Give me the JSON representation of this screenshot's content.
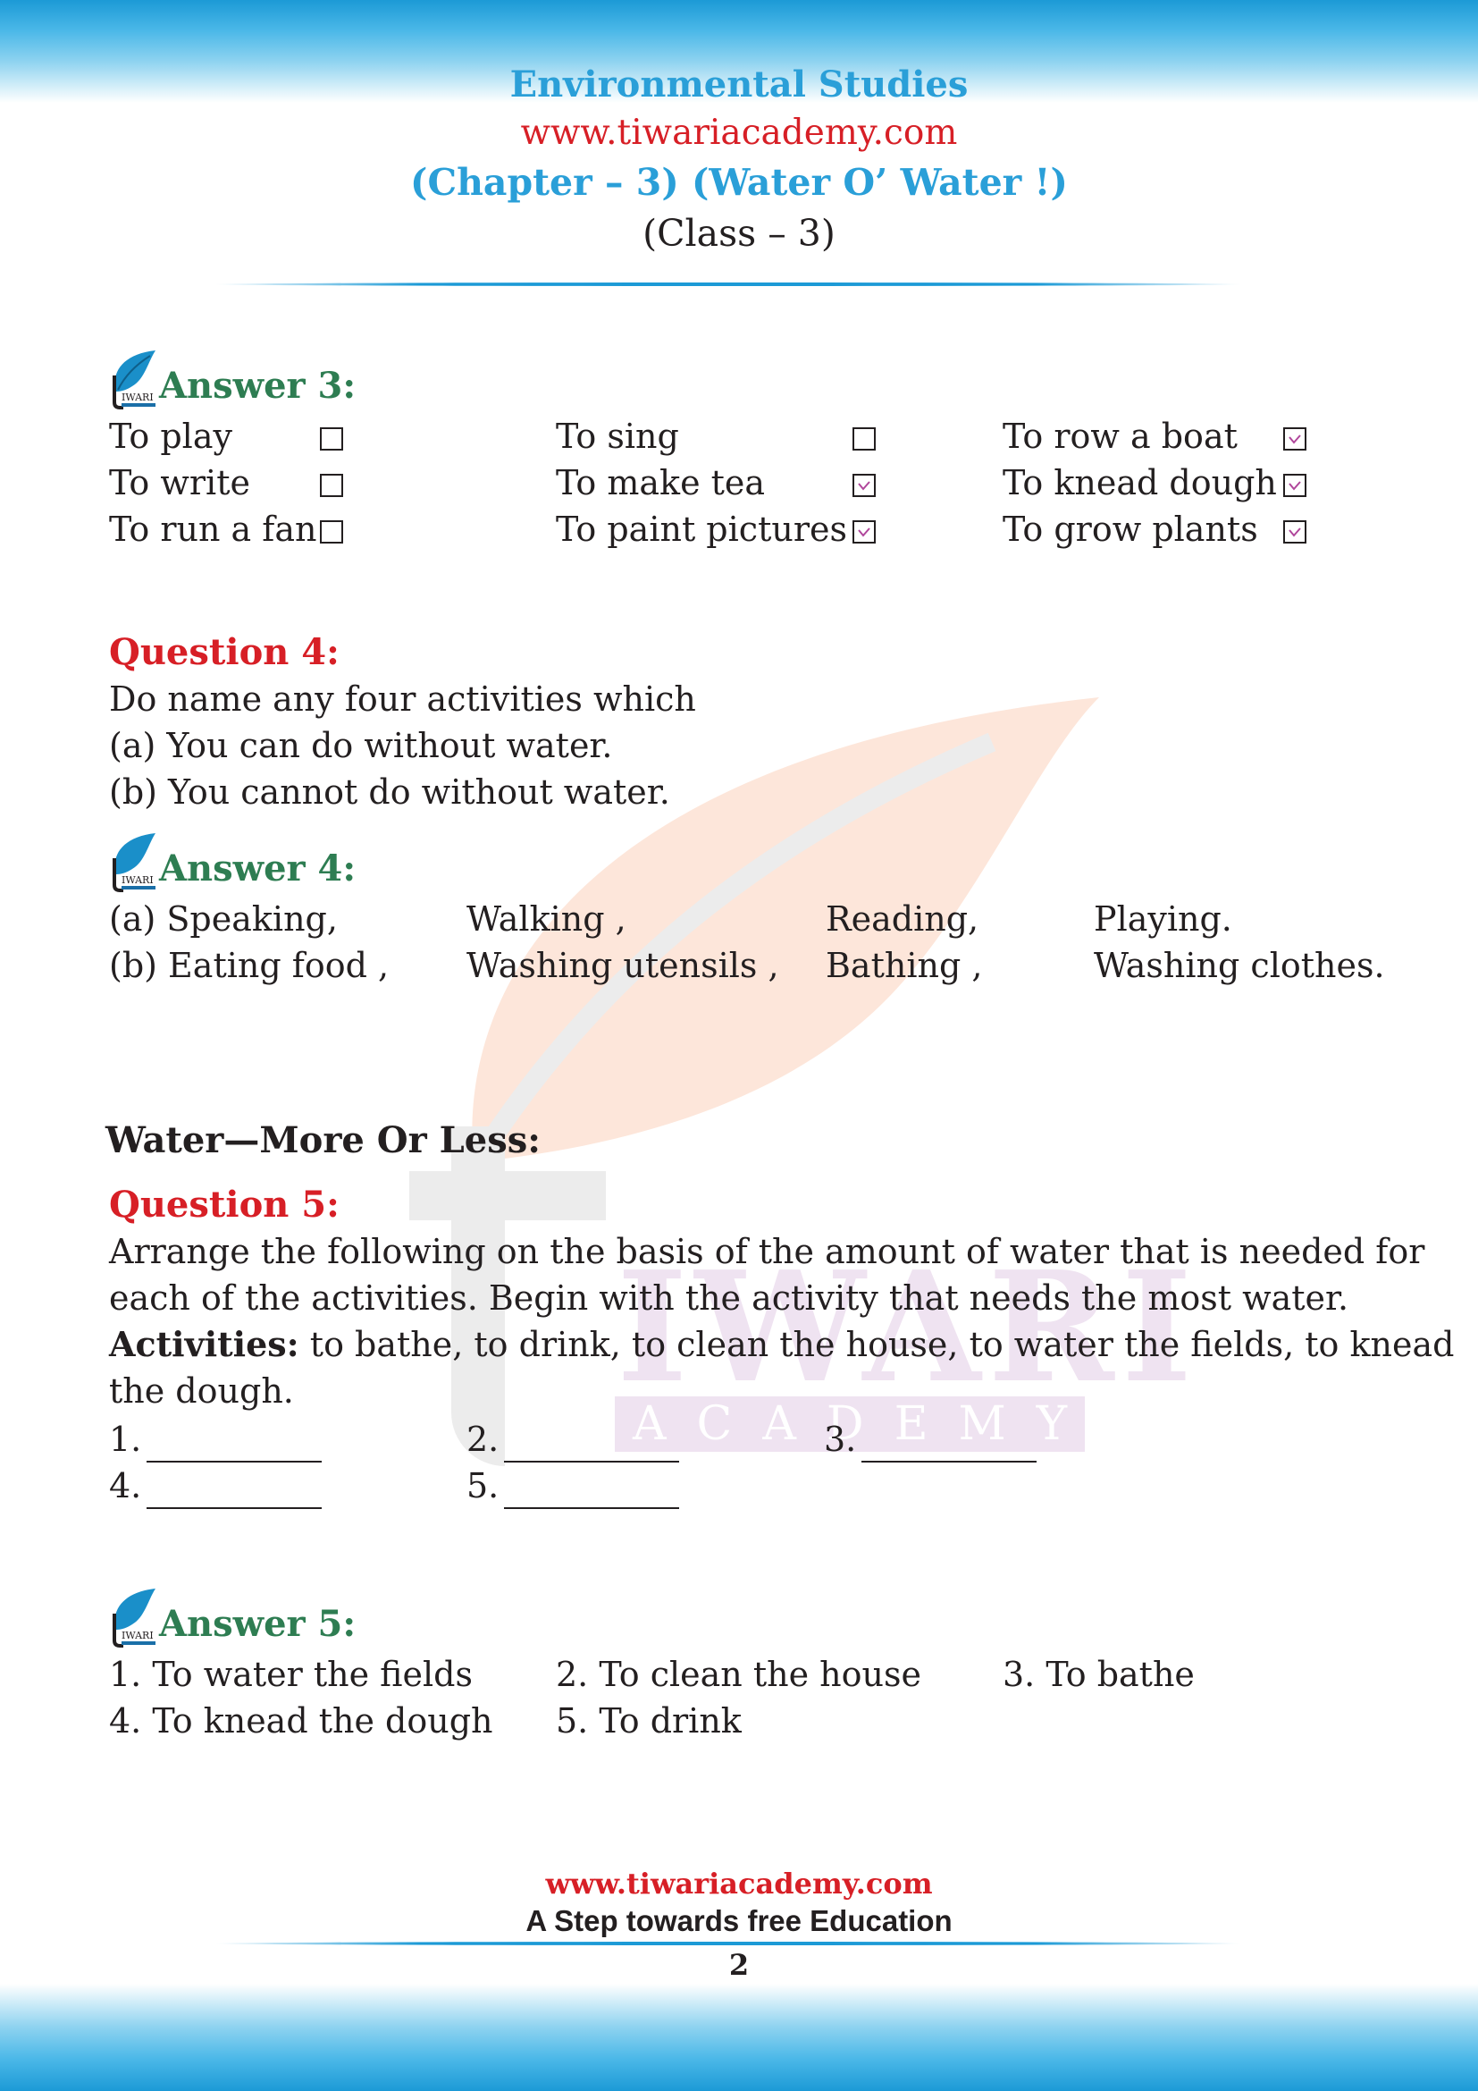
{
  "header": {
    "subject": "Environmental Studies",
    "url": "www.tiwariacademy.com",
    "chapter": "(Chapter – 3) (Water O’ Water !)",
    "class": "(Class – 3)"
  },
  "watermark": {
    "word": "IWARI",
    "sub": "ACADEMY"
  },
  "logo": {
    "icon": "tiwari-academy-leaf-logo",
    "text": "IWARI"
  },
  "answer3": {
    "title": "Answer 3:",
    "items": [
      {
        "label": "To play",
        "checked": false
      },
      {
        "label": "To write",
        "checked": false
      },
      {
        "label": "To run a fan",
        "checked": false
      },
      {
        "label": "To sing",
        "checked": false
      },
      {
        "label": "To make tea",
        "checked": true
      },
      {
        "label": "To paint pictures",
        "checked": true
      },
      {
        "label": "To row a boat",
        "checked": true
      },
      {
        "label": "To knead dough",
        "checked": true
      },
      {
        "label": "To grow plants",
        "checked": true
      }
    ]
  },
  "question4": {
    "title": "Question 4:",
    "lines": [
      "Do name any four activities which",
      "(a) You can do without water.",
      "(b) You cannot do without water."
    ]
  },
  "answer4": {
    "title": "Answer 4:",
    "rows": [
      [
        "(a) Speaking,",
        "Walking ,",
        "Reading,",
        "Playing."
      ],
      [
        "(b) Eating food ,",
        "Washing utensils ,",
        "Bathing ,",
        "Washing clothes."
      ]
    ]
  },
  "section": {
    "title": "Water—More Or Less:"
  },
  "question5": {
    "title": "Question 5:",
    "lines": [
      "Arrange the following on the basis of the amount of water that is needed for",
      "each of the activities. Begin with the activity that needs the most water."
    ],
    "activities_label": "Activities:",
    "activities_text": " to bathe, to drink, to clean the house, to water the fields, to knead",
    "activities_cont": "the dough.",
    "blanks": [
      "1.",
      "2.",
      "3.",
      "4.",
      "5."
    ]
  },
  "answer5": {
    "title": "Answer 5:",
    "items": [
      "1. To water the fields",
      "2. To clean the house",
      "3. To bathe",
      "4. To knead the dough",
      "5. To drink"
    ]
  },
  "footer": {
    "url": "www.tiwariacademy.com",
    "tagline": "A Step towards free Education",
    "page": "2"
  },
  "colors": {
    "brand_blue": "#2a9fd8",
    "brand_red": "#d71f26",
    "answer_green": "#2e7d52",
    "tick_purple": "#b0469b"
  }
}
